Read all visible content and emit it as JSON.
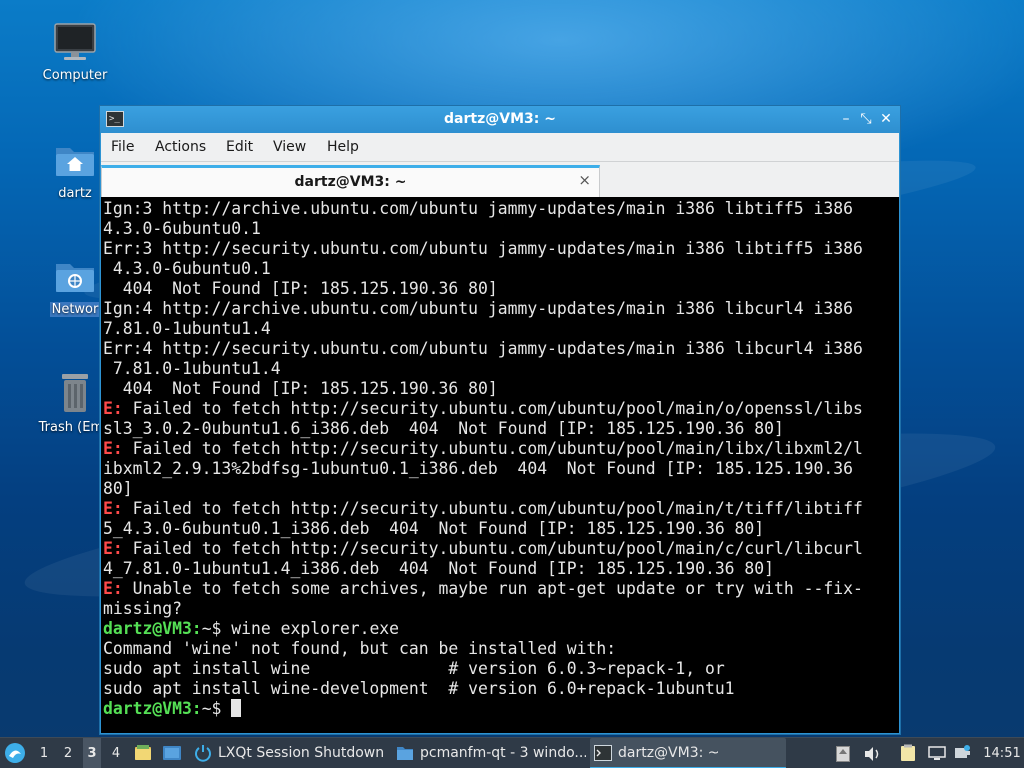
{
  "desktop": {
    "icons": [
      {
        "label": "Computer",
        "icon": "monitor-icon"
      },
      {
        "label": "dartz",
        "icon": "home-folder-icon"
      },
      {
        "label": "Networ",
        "icon": "network-folder-icon"
      },
      {
        "label": "Trash (Emp",
        "icon": "trash-icon"
      }
    ]
  },
  "window": {
    "title": "dartz@VM3: ~",
    "buttons": {
      "minimize": "–",
      "maximize": "⤡",
      "close": "✕"
    },
    "menu": [
      "File",
      "Actions",
      "Edit",
      "View",
      "Help"
    ],
    "tab": {
      "label": "dartz@VM3: ~",
      "close": "×"
    }
  },
  "terminal": {
    "lines": [
      {
        "segments": [
          {
            "t": "Ign:3 http://archive.ubuntu.com/ubuntu jammy-updates/main i386 libtiff5 i386"
          }
        ]
      },
      {
        "segments": [
          {
            "t": "4.3.0-6ubuntu0.1"
          }
        ]
      },
      {
        "segments": [
          {
            "t": "Err:3 http://security.ubuntu.com/ubuntu jammy-updates/main i386 libtiff5 i386"
          }
        ]
      },
      {
        "segments": [
          {
            "t": " 4.3.0-6ubuntu0.1"
          }
        ]
      },
      {
        "segments": [
          {
            "t": "  404  Not Found [IP: 185.125.190.36 80]"
          }
        ]
      },
      {
        "segments": [
          {
            "t": "Ign:4 http://archive.ubuntu.com/ubuntu jammy-updates/main i386 libcurl4 i386"
          }
        ]
      },
      {
        "segments": [
          {
            "t": "7.81.0-1ubuntu1.4"
          }
        ]
      },
      {
        "segments": [
          {
            "t": "Err:4 http://security.ubuntu.com/ubuntu jammy-updates/main i386 libcurl4 i386"
          }
        ]
      },
      {
        "segments": [
          {
            "t": " 7.81.0-1ubuntu1.4"
          }
        ]
      },
      {
        "segments": [
          {
            "t": "  404  Not Found [IP: 185.125.190.36 80]"
          }
        ]
      },
      {
        "segments": [
          {
            "t": "E:",
            "c": "err"
          },
          {
            "t": " Failed to fetch http://security.ubuntu.com/ubuntu/pool/main/o/openssl/libs"
          }
        ]
      },
      {
        "segments": [
          {
            "t": "sl3_3.0.2-0ubuntu1.6_i386.deb  404  Not Found [IP: 185.125.190.36 80]"
          }
        ]
      },
      {
        "segments": [
          {
            "t": "E:",
            "c": "err"
          },
          {
            "t": " Failed to fetch http://security.ubuntu.com/ubuntu/pool/main/libx/libxml2/l"
          }
        ]
      },
      {
        "segments": [
          {
            "t": "ibxml2_2.9.13%2bdfsg-1ubuntu0.1_i386.deb  404  Not Found [IP: 185.125.190.36"
          }
        ]
      },
      {
        "segments": [
          {
            "t": "80]"
          }
        ]
      },
      {
        "segments": [
          {
            "t": "E:",
            "c": "err"
          },
          {
            "t": " Failed to fetch http://security.ubuntu.com/ubuntu/pool/main/t/tiff/libtiff"
          }
        ]
      },
      {
        "segments": [
          {
            "t": "5_4.3.0-6ubuntu0.1_i386.deb  404  Not Found [IP: 185.125.190.36 80]"
          }
        ]
      },
      {
        "segments": [
          {
            "t": "E:",
            "c": "err"
          },
          {
            "t": " Failed to fetch http://security.ubuntu.com/ubuntu/pool/main/c/curl/libcurl"
          }
        ]
      },
      {
        "segments": [
          {
            "t": "4_7.81.0-1ubuntu1.4_i386.deb  404  Not Found [IP: 185.125.190.36 80]"
          }
        ]
      },
      {
        "segments": [
          {
            "t": "E:",
            "c": "err"
          },
          {
            "t": " Unable to fetch some archives, maybe run apt-get update or try with --fix-"
          }
        ]
      },
      {
        "segments": [
          {
            "t": "missing?"
          }
        ]
      },
      {
        "segments": [
          {
            "t": "dartz@VM3:",
            "c": "prompt"
          },
          {
            "t": "~$ wine explorer.exe"
          }
        ]
      },
      {
        "segments": [
          {
            "t": "Command 'wine' not found, but can be installed with:"
          }
        ]
      },
      {
        "segments": [
          {
            "t": "sudo apt install wine              # version 6.0.3~repack-1, or"
          }
        ]
      },
      {
        "segments": [
          {
            "t": "sudo apt install wine-development  # version 6.0+repack-1ubuntu1"
          }
        ]
      },
      {
        "segments": [
          {
            "t": "dartz@VM3:",
            "c": "prompt"
          },
          {
            "t": "~$ "
          }
        ],
        "cursor": true
      }
    ]
  },
  "taskbar": {
    "workspaces": [
      "1",
      "2",
      "3",
      "4"
    ],
    "active_workspace": "3",
    "tasks": [
      {
        "label": "LXQt Session Shutdown",
        "icon": "shutdown-icon",
        "active": false
      },
      {
        "label": "pcmanfm-qt - 3 windo...",
        "icon": "folder-icon",
        "active": false
      },
      {
        "label": "dartz@VM3: ~",
        "icon": "terminal-icon",
        "active": true
      }
    ],
    "clock": "14:51"
  },
  "colors": {
    "accent": "#3daee9",
    "titlebar": "#2e8fd0",
    "prompt": "#55e055",
    "error": "#ff4a4a",
    "taskbar": "#2f3a47"
  }
}
